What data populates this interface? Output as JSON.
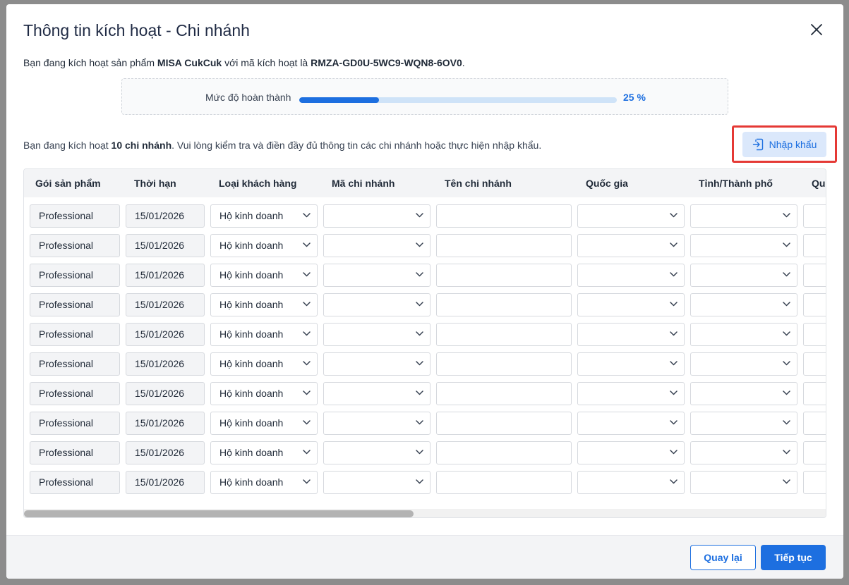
{
  "dialog": {
    "title": "Thông tin kích hoạt - Chi nhánh",
    "close_icon": "close-icon"
  },
  "intro": {
    "prefix": "Bạn đang kích hoạt sản phẩm ",
    "product": "MISA CukCuk",
    "middle": " với mã kích hoạt là ",
    "code": "RMZA-GD0U-5WC9-WQN8-6OV0",
    "suffix": "."
  },
  "progress": {
    "label": "Mức độ hoàn thành",
    "percent_text": "25 %",
    "value": 0.25
  },
  "branch_info": {
    "prefix": "Bạn đang kích hoạt ",
    "count": "10 chi nhánh",
    "suffix": ". Vui lòng kiểm tra và điền đầy đủ thông tin các chi nhánh hoặc thực hiện nhập khẩu."
  },
  "import_button": {
    "label": "Nhập khẩu",
    "icon": "import-icon"
  },
  "table": {
    "headers": [
      "Gói sản phẩm",
      "Thời hạn",
      "Loại khách hàng",
      "Mã chi nhánh",
      "Tên chi nhánh",
      "Quốc gia",
      "Tỉnh/Thành phố",
      "Qu"
    ],
    "rows": [
      {
        "package": "Professional",
        "term": "15/01/2026",
        "customer_type": "Hộ kinh doanh",
        "branch_code": "",
        "branch_name": "",
        "country": "",
        "province": ""
      },
      {
        "package": "Professional",
        "term": "15/01/2026",
        "customer_type": "Hộ kinh doanh",
        "branch_code": "",
        "branch_name": "",
        "country": "",
        "province": ""
      },
      {
        "package": "Professional",
        "term": "15/01/2026",
        "customer_type": "Hộ kinh doanh",
        "branch_code": "",
        "branch_name": "",
        "country": "",
        "province": ""
      },
      {
        "package": "Professional",
        "term": "15/01/2026",
        "customer_type": "Hộ kinh doanh",
        "branch_code": "",
        "branch_name": "",
        "country": "",
        "province": ""
      },
      {
        "package": "Professional",
        "term": "15/01/2026",
        "customer_type": "Hộ kinh doanh",
        "branch_code": "",
        "branch_name": "",
        "country": "",
        "province": ""
      },
      {
        "package": "Professional",
        "term": "15/01/2026",
        "customer_type": "Hộ kinh doanh",
        "branch_code": "",
        "branch_name": "",
        "country": "",
        "province": ""
      },
      {
        "package": "Professional",
        "term": "15/01/2026",
        "customer_type": "Hộ kinh doanh",
        "branch_code": "",
        "branch_name": "",
        "country": "",
        "province": ""
      },
      {
        "package": "Professional",
        "term": "15/01/2026",
        "customer_type": "Hộ kinh doanh",
        "branch_code": "",
        "branch_name": "",
        "country": "",
        "province": ""
      },
      {
        "package": "Professional",
        "term": "15/01/2026",
        "customer_type": "Hộ kinh doanh",
        "branch_code": "",
        "branch_name": "",
        "country": "",
        "province": ""
      },
      {
        "package": "Professional",
        "term": "15/01/2026",
        "customer_type": "Hộ kinh doanh",
        "branch_code": "",
        "branch_name": "",
        "country": "",
        "province": ""
      }
    ]
  },
  "footer": {
    "back_label": "Quay lại",
    "next_label": "Tiếp tục"
  },
  "colors": {
    "primary": "#1d6fe0",
    "highlight_border": "#e53935",
    "progress_track": "#cfe3f8"
  }
}
